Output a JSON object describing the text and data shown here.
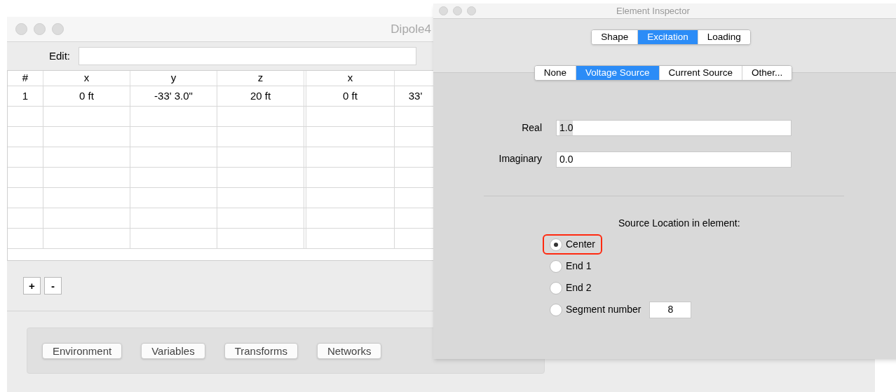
{
  "main_window": {
    "title": "Dipole4",
    "edit_label": "Edit:",
    "table": {
      "columns": [
        "#",
        "x",
        "y",
        "z",
        "x"
      ],
      "rows": [
        [
          "1",
          "0 ft",
          "-33' 3.0\"",
          "20 ft",
          "0 ft",
          "33'"
        ]
      ]
    },
    "row_buttons": [
      "+",
      "-"
    ],
    "bottom_buttons": [
      "Environment",
      "Variables",
      "Transforms",
      "Networks"
    ]
  },
  "inspector": {
    "title": "Element Inspector",
    "tabs": [
      {
        "label": "Shape",
        "selected": false
      },
      {
        "label": "Excitation",
        "selected": true
      },
      {
        "label": "Loading",
        "selected": false
      }
    ],
    "source_types": [
      {
        "label": "None",
        "selected": false
      },
      {
        "label": "Voltage Source",
        "selected": true
      },
      {
        "label": "Current Source",
        "selected": false
      },
      {
        "label": "Other...",
        "selected": false
      }
    ],
    "fields": [
      {
        "label": "Real",
        "value": "1.0"
      },
      {
        "label": "Imaginary",
        "value": "0.0"
      }
    ],
    "location_label": "Source Location in element:",
    "locations": [
      {
        "label": "Center",
        "selected": true,
        "highlighted": true
      },
      {
        "label": "End 1",
        "selected": false,
        "highlighted": false
      },
      {
        "label": "End 2",
        "selected": false,
        "highlighted": false
      },
      {
        "label": "Segment number",
        "selected": false,
        "highlighted": false,
        "value": "8"
      }
    ]
  }
}
